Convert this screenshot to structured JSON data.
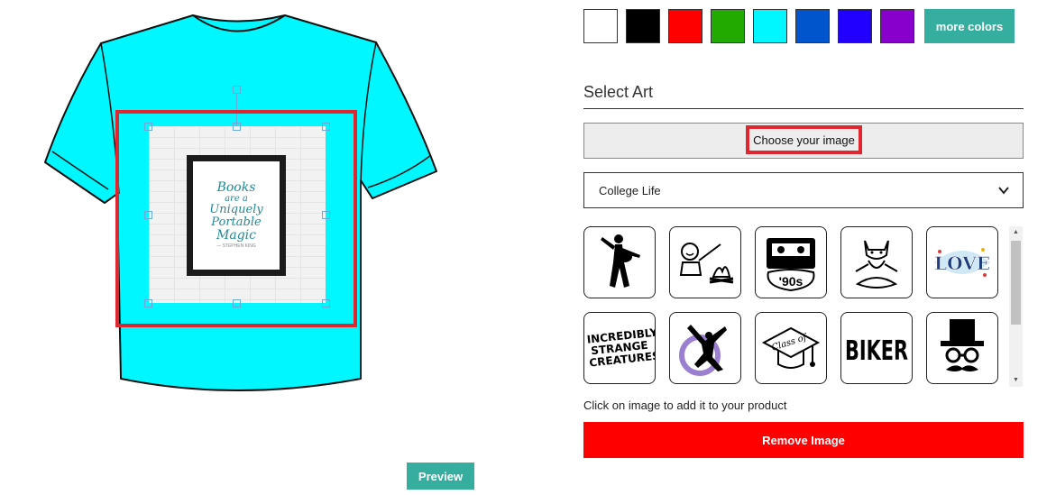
{
  "preview": {
    "shirt_color": "#00f7ff",
    "artwork_quote": {
      "line1": "Books",
      "line2": "are a",
      "line3": "Uniquely",
      "line4": "Portable",
      "line5": "Magic",
      "author": "— STEPHEN KING"
    },
    "preview_label": "Preview"
  },
  "colors": {
    "swatches": [
      {
        "name": "white",
        "hex": "#ffffff"
      },
      {
        "name": "black",
        "hex": "#000000"
      },
      {
        "name": "red",
        "hex": "#ff0000"
      },
      {
        "name": "green",
        "hex": "#22aa00"
      },
      {
        "name": "cyan",
        "hex": "#00f7ff"
      },
      {
        "name": "blue",
        "hex": "#0055cc"
      },
      {
        "name": "indigo",
        "hex": "#2200ff"
      },
      {
        "name": "purple",
        "hex": "#8800cc"
      }
    ],
    "more_label": "more colors"
  },
  "select_art": {
    "title": "Select Art",
    "choose_label": "Choose your image",
    "category_value": "College Life",
    "chevron_icon": "chevron-down-icon",
    "art_items": [
      {
        "icon": "guitar-player-icon"
      },
      {
        "icon": "campfire-smores-icon"
      },
      {
        "icon": "cassette-90s-icon",
        "text": "'90s"
      },
      {
        "icon": "meditating-cat-icon"
      },
      {
        "icon": "love-lettering-icon",
        "text": "LOVE"
      },
      {
        "icon": "strange-creatures-icon",
        "text": "INCREDIBLY STRANGE CREATURES"
      },
      {
        "icon": "dancer-silhouette-icon"
      },
      {
        "icon": "class-of-cap-icon",
        "text": "Class of"
      },
      {
        "icon": "biker-text-icon",
        "text": "BIKER"
      },
      {
        "icon": "top-hat-mustache-icon"
      }
    ],
    "hint": "Click on image to add it to your product",
    "remove_label": "Remove Image"
  }
}
